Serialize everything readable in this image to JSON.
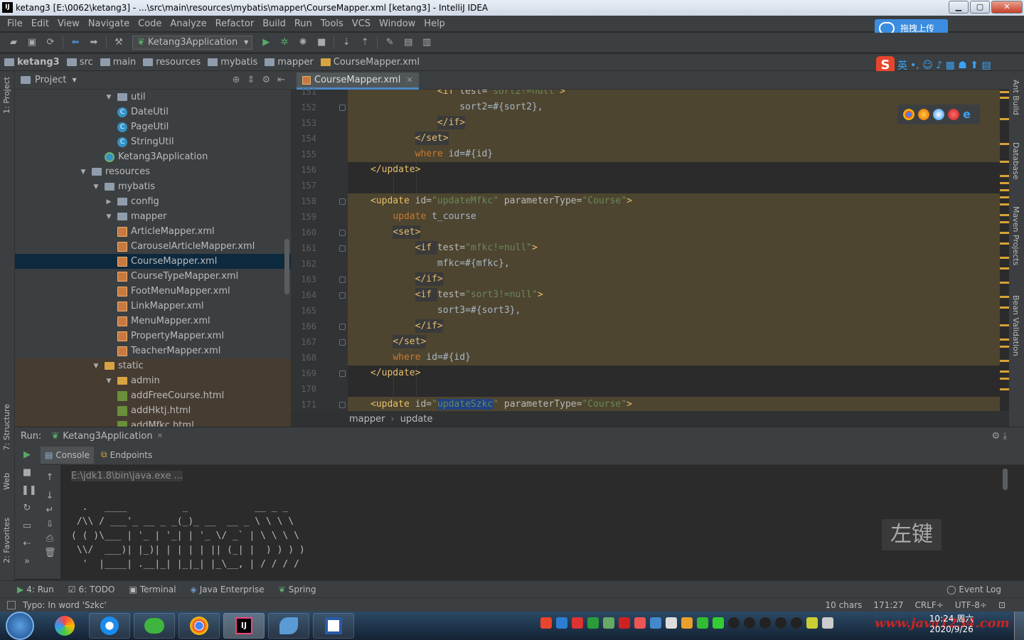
{
  "window": {
    "title": "ketang3 [E:\\0062\\ketang3] - ...\\src\\main\\resources\\mybatis\\mapper\\CourseMapper.xml [ketang3] - IntelliJ IDEA",
    "app_icon": "IJ",
    "minimize": "▁",
    "maximize": "▢",
    "close": "✕"
  },
  "menu": [
    "File",
    "Edit",
    "View",
    "Navigate",
    "Code",
    "Analyze",
    "Refactor",
    "Build",
    "Run",
    "Tools",
    "VCS",
    "Window",
    "Help"
  ],
  "baidu_button": "拖拽上传",
  "toolbar": {
    "run_config": "Ketang3Application"
  },
  "navbar": {
    "crumbs": [
      "ketang3",
      "src",
      "main",
      "resources",
      "mybatis",
      "mapper",
      "CourseMapper.xml"
    ]
  },
  "ime": {
    "logo": "S",
    "lang": "英",
    "icons": "•, ☺ ♪ ▦ ☗ ⬆ ▤"
  },
  "project_panel": {
    "title": "Project"
  },
  "tree": [
    {
      "label": "util",
      "indent": 1,
      "icon": "folder",
      "twisty": "▼"
    },
    {
      "label": "DateUtil",
      "indent": 2,
      "icon": "class",
      "twisty": ""
    },
    {
      "label": "PageUtil",
      "indent": 2,
      "icon": "class",
      "twisty": ""
    },
    {
      "label": "StringUtil",
      "indent": 2,
      "icon": "class",
      "twisty": ""
    },
    {
      "label": "Ketang3Application",
      "indent": 1.5,
      "icon": "app",
      "twisty": ""
    },
    {
      "label": "resources",
      "indent": 0,
      "icon": "folder",
      "twisty": "▼"
    },
    {
      "label": "mybatis",
      "indent": 0.5,
      "icon": "folder",
      "twisty": "▼"
    },
    {
      "label": "config",
      "indent": 1,
      "icon": "folder",
      "twisty": "▶"
    },
    {
      "label": "mapper",
      "indent": 1,
      "icon": "folder",
      "twisty": "▼"
    },
    {
      "label": "ArticleMapper.xml",
      "indent": 2,
      "icon": "xml",
      "twisty": ""
    },
    {
      "label": "CarouselArticleMapper.xml",
      "indent": 2,
      "icon": "xml",
      "twisty": ""
    },
    {
      "label": "CourseMapper.xml",
      "indent": 2,
      "icon": "xml",
      "twisty": "",
      "state": "selected"
    },
    {
      "label": "CourseTypeMapper.xml",
      "indent": 2,
      "icon": "xml",
      "twisty": ""
    },
    {
      "label": "FootMenuMapper.xml",
      "indent": 2,
      "icon": "xml",
      "twisty": ""
    },
    {
      "label": "LinkMapper.xml",
      "indent": 2,
      "icon": "xml",
      "twisty": ""
    },
    {
      "label": "MenuMapper.xml",
      "indent": 2,
      "icon": "xml",
      "twisty": ""
    },
    {
      "label": "PropertyMapper.xml",
      "indent": 2,
      "icon": "xml",
      "twisty": ""
    },
    {
      "label": "TeacherMapper.xml",
      "indent": 2,
      "icon": "xml",
      "twisty": ""
    },
    {
      "label": "static",
      "indent": 0.5,
      "icon": "folder-orange",
      "twisty": "▼",
      "state": "highlight"
    },
    {
      "label": "admin",
      "indent": 1,
      "icon": "folder-orange",
      "twisty": "▼",
      "state": "highlight"
    },
    {
      "label": "addFreeCourse.html",
      "indent": 2,
      "icon": "html",
      "twisty": "",
      "state": "highlight"
    },
    {
      "label": "addHktj.html",
      "indent": 2,
      "icon": "html",
      "twisty": "",
      "state": "highlight"
    },
    {
      "label": "addMfkc.html",
      "indent": 2,
      "icon": "html",
      "twisty": "",
      "state": "highlight"
    }
  ],
  "editor": {
    "tab": "CourseMapper.xml",
    "lines": [
      {
        "n": "151",
        "html": "            <span class='tag'>&lt;if </span><span class='attr'>test=</span><span class='str'>\"sort2!=null\"</span><span class='tag'>&gt;</span>",
        "hl": true
      },
      {
        "n": "152",
        "html": "                <span class='mono'>sort2=#{sort2},</span>",
        "hl": true
      },
      {
        "n": "153",
        "html": "            <span class='tag tb2'>&lt;/if&gt;</span>",
        "hl": true
      },
      {
        "n": "154",
        "html": "        <span class='tag tb2'>&lt;/set&gt;</span>",
        "hl": true
      },
      {
        "n": "155",
        "html": "        <span class='kw'>where</span> id=#{id}",
        "hl": true
      },
      {
        "n": "156",
        "html": "<span class='tag'>&lt;/update&gt;</span>",
        "hl": false
      },
      {
        "n": "157",
        "html": "",
        "hl": false
      },
      {
        "n": "158",
        "html": "<span class='tag'>&lt;update </span><span class='attr'>id=</span><span class='str'>\"updateMfkc\"</span> <span class='attr'>parameterType=</span><span class='str'>\"Course\"</span><span class='tag'>&gt;</span>",
        "hl": true
      },
      {
        "n": "159",
        "html": "    <span class='kw'>update</span> t_course",
        "hl": true
      },
      {
        "n": "160",
        "html": "    <span class='tag tb2'>&lt;set&gt;</span>",
        "hl": true
      },
      {
        "n": "161",
        "html": "        <span class='tag tb2'>&lt;if </span><span class='attr'>test=</span><span class='str'>\"mfkc!=null\"</span><span class='tag'>&gt;</span>",
        "hl": true
      },
      {
        "n": "162",
        "html": "            mfkc=#{mfkc},",
        "hl": true
      },
      {
        "n": "163",
        "html": "        <span class='tag tb2'>&lt;/if&gt;</span>",
        "hl": true
      },
      {
        "n": "164",
        "html": "        <span class='tag tb2'>&lt;if </span><span class='attr'>test=</span><span class='str'>\"sort3!=null\"</span><span class='tag'>&gt;</span>",
        "hl": true
      },
      {
        "n": "165",
        "html": "            sort3=#{sort3},",
        "hl": true
      },
      {
        "n": "166",
        "html": "        <span class='tag tb2'>&lt;/if&gt;</span>",
        "hl": true
      },
      {
        "n": "167",
        "html": "    <span class='tag tb2'>&lt;/set&gt;</span>",
        "hl": true
      },
      {
        "n": "168",
        "html": "    <span class='kw'>where</span> id=#{id}",
        "hl": true
      },
      {
        "n": "169",
        "html": "<span class='tag'>&lt;/update&gt;</span>",
        "hl": false
      },
      {
        "n": "170",
        "html": "",
        "hl": false
      },
      {
        "n": "171",
        "html": "<span class='tag'>&lt;update </span><span class='attr'>id=</span><span class='str'>\"<span class='sel2'>updateSzkc</span>\"</span> <span class='attr'>parameterType=</span><span class='str'>\"Course\"</span><span class='tag'>&gt;</span>",
        "hl": true
      }
    ],
    "breadcrumb": [
      "mapper",
      "update"
    ]
  },
  "run": {
    "label": "Run:",
    "config": "Ketang3Application",
    "tabs": [
      "Console",
      "Endpoints"
    ],
    "console_cmd": "E:\\jdk1.8\\bin\\java.exe ...",
    "banner": [
      "  .   ____          _            __ _ _",
      " /\\\\ / ___'_ __ _ _(_)_ __  __ _ \\ \\ \\ \\",
      "( ( )\\___ | '_ | '_| | '_ \\/ _` | \\ \\ \\ \\",
      " \\\\/  ___)| |_)| | | | | || (_| |  ) ) ) )",
      "  '  |____| .__|_| |_|_| |_\\__, | / / / /"
    ],
    "overlay_text": "左键"
  },
  "bottom_tabs": [
    {
      "icon": "▶",
      "label": "4: Run"
    },
    {
      "icon": "☑",
      "label": "6: TODO"
    },
    {
      "icon": "▣",
      "label": "Terminal"
    },
    {
      "icon": "◈",
      "label": "Java Enterprise"
    },
    {
      "icon": "❦",
      "label": "Spring"
    }
  ],
  "event_log": "Event Log",
  "status": {
    "message": "Typo: In word 'Szkc'",
    "chars": "10 chars",
    "position": "171:27",
    "line_sep": "CRLF÷",
    "encoding": "UTF-8÷"
  },
  "side_labels": {
    "left_top": "1: Project",
    "left_structure": "7: Structure",
    "left_web": "Web",
    "left_fav": "2: Favorites",
    "right": [
      "Ant Build",
      "Database",
      "Maven Projects",
      "Bean Validation"
    ]
  },
  "taskbar": {
    "clock_time": "10:24 周六",
    "clock_date": "2020/9/26",
    "watermark": "www.java1234.com"
  },
  "colors": {
    "accent": "#4a88c7",
    "highlight": "#4d4530",
    "selected": "#0d293e"
  }
}
